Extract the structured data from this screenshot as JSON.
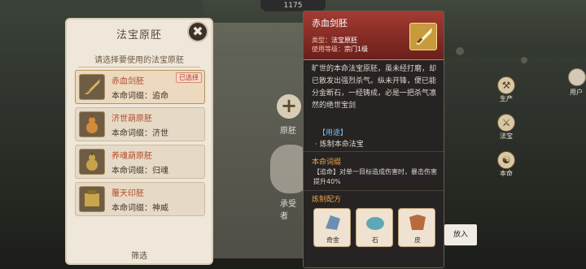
{
  "top": {
    "counter": "1175"
  },
  "left_panel": {
    "title": "法宝原胚",
    "close_icon": "close-icon",
    "subtitle": "请选择要使用的法宝原胚",
    "items": [
      {
        "name": "赤血剑胚",
        "affix": "本命词缀：追命",
        "tag": "已选择",
        "selected": true,
        "icon": "sword-icon"
      },
      {
        "name": "济世葫原胚",
        "affix": "本命词缀：济世",
        "tag": "",
        "selected": false,
        "icon": "gourd-icon"
      },
      {
        "name": "养魂葫原胚",
        "affix": "本命词缀：归魂",
        "tag": "",
        "selected": false,
        "icon": "gourd-icon"
      },
      {
        "name": "覆天印胚",
        "affix": "本命词缀：神威",
        "tag": "",
        "selected": false,
        "icon": "seal-icon"
      }
    ],
    "filter_label": "筛选"
  },
  "middle": {
    "label1": "原胚",
    "label2": "承受者"
  },
  "detail": {
    "title": "赤血剑胚",
    "type_label": "类型：",
    "type_value": "法宝原胚",
    "level_label": "使用等级：",
    "level_value": "宗门1级",
    "description": "旷世的本命法宝原胚，虽未经打磨，却已散发出强烈杀气。纵未开锋，便已能分金断石，一经铸成，必是一把杀气凛然的绝世宝剑",
    "use_header": "【用途】",
    "use_text": "· 炼制本命法宝",
    "affix_header": "本命词缀",
    "affix_text": "【追命】对单一目标造成伤害时，暴击伤害提升40%",
    "recipe_header": "炼制配方",
    "materials": [
      {
        "label": "奇金",
        "icon": "metal-icon",
        "color": "#6b8fb0"
      },
      {
        "label": "石",
        "icon": "stone-icon",
        "color": "#5fa7b5"
      },
      {
        "label": "皮",
        "icon": "hide-icon",
        "color": "#b86a3f"
      }
    ]
  },
  "put_in_label": "放入",
  "sidebar": [
    {
      "label": "生产",
      "icon": "produce-icon"
    },
    {
      "label": "法宝",
      "icon": "treasure-icon"
    },
    {
      "label": "本命",
      "icon": "natal-icon"
    }
  ],
  "user_label": "用户",
  "colors": {
    "accent_red": "#a33b32",
    "gold": "#e6a24c",
    "blue_link": "#76b8f0"
  }
}
